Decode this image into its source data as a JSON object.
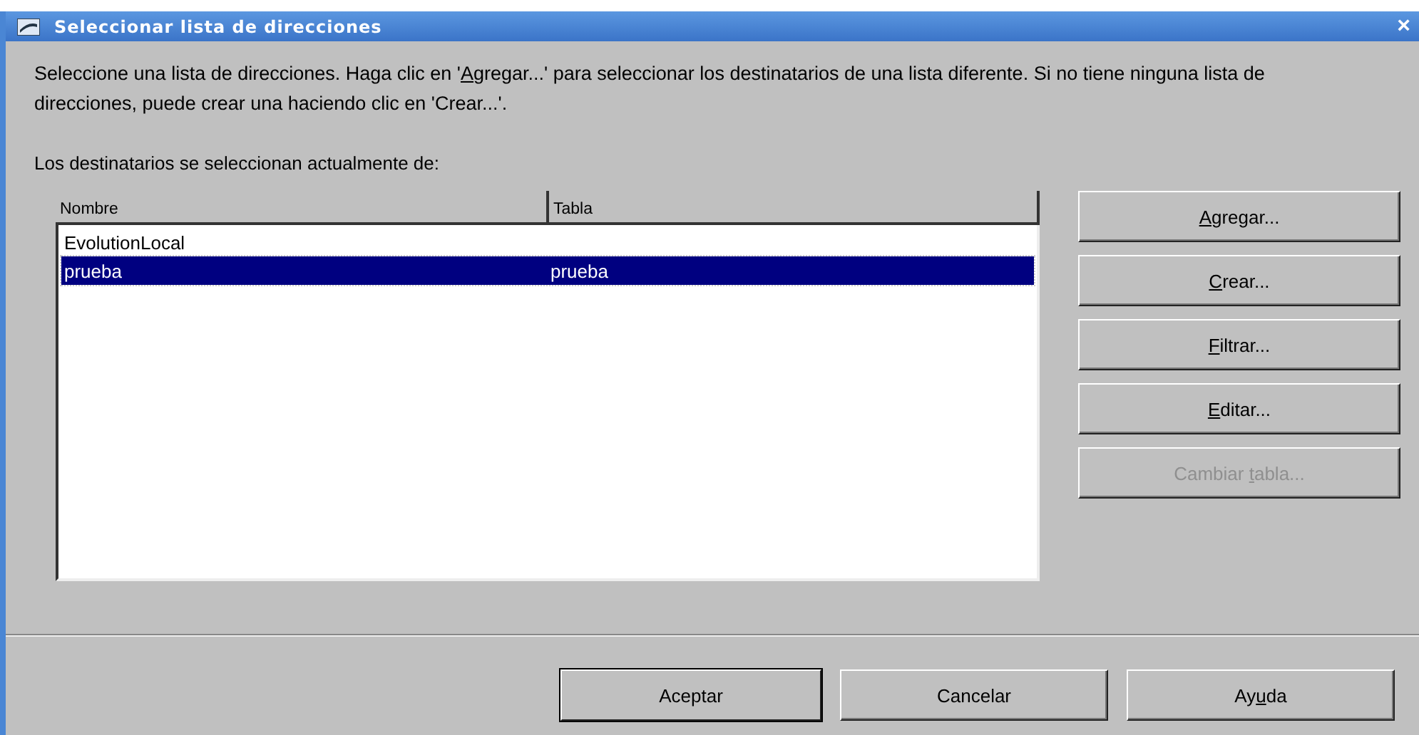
{
  "window": {
    "title": "Seleccionar lista de direcciones",
    "close": "×"
  },
  "description": [
    {
      "text": "Seleccione una lista de direcciones. Haga clic en '",
      "underline": false
    },
    {
      "text": "A",
      "underline": true
    },
    {
      "text": "gregar...' para seleccionar los destinatarios de una lista diferente. Si no tiene ninguna lista de direcciones, puede crear una haciendo clic en 'Crear...'.",
      "underline": false
    }
  ],
  "current_label": "Los destinatarios se seleccionan actualmente de:",
  "table": {
    "columns": [
      "Nombre",
      "Tabla"
    ],
    "rows": [
      {
        "cells": [
          "EvolutionLocal",
          ""
        ],
        "selected": false
      },
      {
        "cells": [
          "prueba",
          "prueba"
        ],
        "selected": true
      }
    ]
  },
  "side_buttons": [
    {
      "parts": [
        {
          "text": "A",
          "underline": true
        },
        {
          "text": "gregar...",
          "underline": false
        }
      ],
      "disabled": false
    },
    {
      "parts": [
        {
          "text": "C",
          "underline": true
        },
        {
          "text": "rear...",
          "underline": false
        }
      ],
      "disabled": false
    },
    {
      "parts": [
        {
          "text": "F",
          "underline": true
        },
        {
          "text": "iltrar...",
          "underline": false
        }
      ],
      "disabled": false
    },
    {
      "parts": [
        {
          "text": "E",
          "underline": true
        },
        {
          "text": "ditar...",
          "underline": false
        }
      ],
      "disabled": false
    },
    {
      "parts": [
        {
          "text": "Cambiar ",
          "underline": false
        },
        {
          "text": "t",
          "underline": true
        },
        {
          "text": "abla...",
          "underline": false
        }
      ],
      "disabled": true
    }
  ],
  "footer_buttons": [
    {
      "parts": [
        {
          "text": "Aceptar",
          "underline": false
        }
      ],
      "default": true
    },
    {
      "parts": [
        {
          "text": "Cancelar",
          "underline": false
        }
      ],
      "default": false
    },
    {
      "parts": [
        {
          "text": "Ay",
          "underline": false
        },
        {
          "text": "u",
          "underline": true
        },
        {
          "text": "da",
          "underline": false
        }
      ],
      "default": false
    }
  ]
}
